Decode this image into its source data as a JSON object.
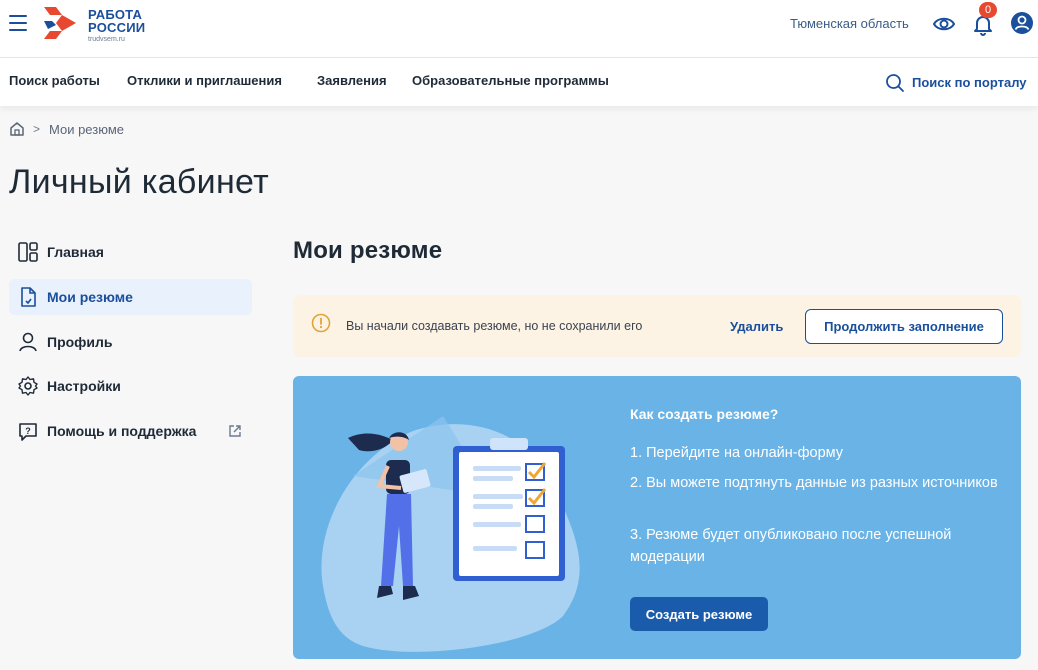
{
  "header": {
    "logo_line1": "РАБОТА",
    "logo_line2": "РОССИИ",
    "logo_sub": "trudvsem.ru",
    "region": "Тюменская область",
    "notifications_count": "0",
    "icons": [
      "menu-icon",
      "eye-icon",
      "bell-icon",
      "user-icon"
    ]
  },
  "nav": {
    "items": [
      "Поиск работы",
      "Отклики и приглашения",
      "Заявления",
      "Образовательные программы"
    ],
    "search_label": "Поиск по порталу"
  },
  "breadcrumb": {
    "separator": ">",
    "current": "Мои резюме"
  },
  "page_title": "Личный кабинет",
  "sidebar": {
    "items": [
      {
        "label": "Главная",
        "icon": "dashboard-icon",
        "active": false
      },
      {
        "label": "Мои резюме",
        "icon": "document-icon",
        "active": true
      },
      {
        "label": "Профиль",
        "icon": "person-icon",
        "active": false
      },
      {
        "label": "Настройки",
        "icon": "gear-icon",
        "active": false
      },
      {
        "label": "Помощь и поддержка",
        "icon": "help-chat-icon",
        "active": false
      }
    ]
  },
  "main": {
    "title": "Мои резюме",
    "alert": {
      "text": "Вы начали создавать резюме, но не сохранили его",
      "delete_label": "Удалить",
      "continue_label": "Продолжить заполнение"
    },
    "promo": {
      "title": "Как создать резюме?",
      "steps": [
        "1. Перейдите на онлайн-форму",
        "2. Вы можете подтянуть данные из разных источников",
        "3. Резюме будет опубликовано после успешной модерации"
      ],
      "button_label": "Создать резюме"
    }
  },
  "colors": {
    "brand": "#1a4f9c",
    "accent_red": "#e8482f",
    "alert_bg": "#fdf3e5",
    "promo_bg": "#6ab3e6",
    "active_bg": "#e8f1fc"
  }
}
